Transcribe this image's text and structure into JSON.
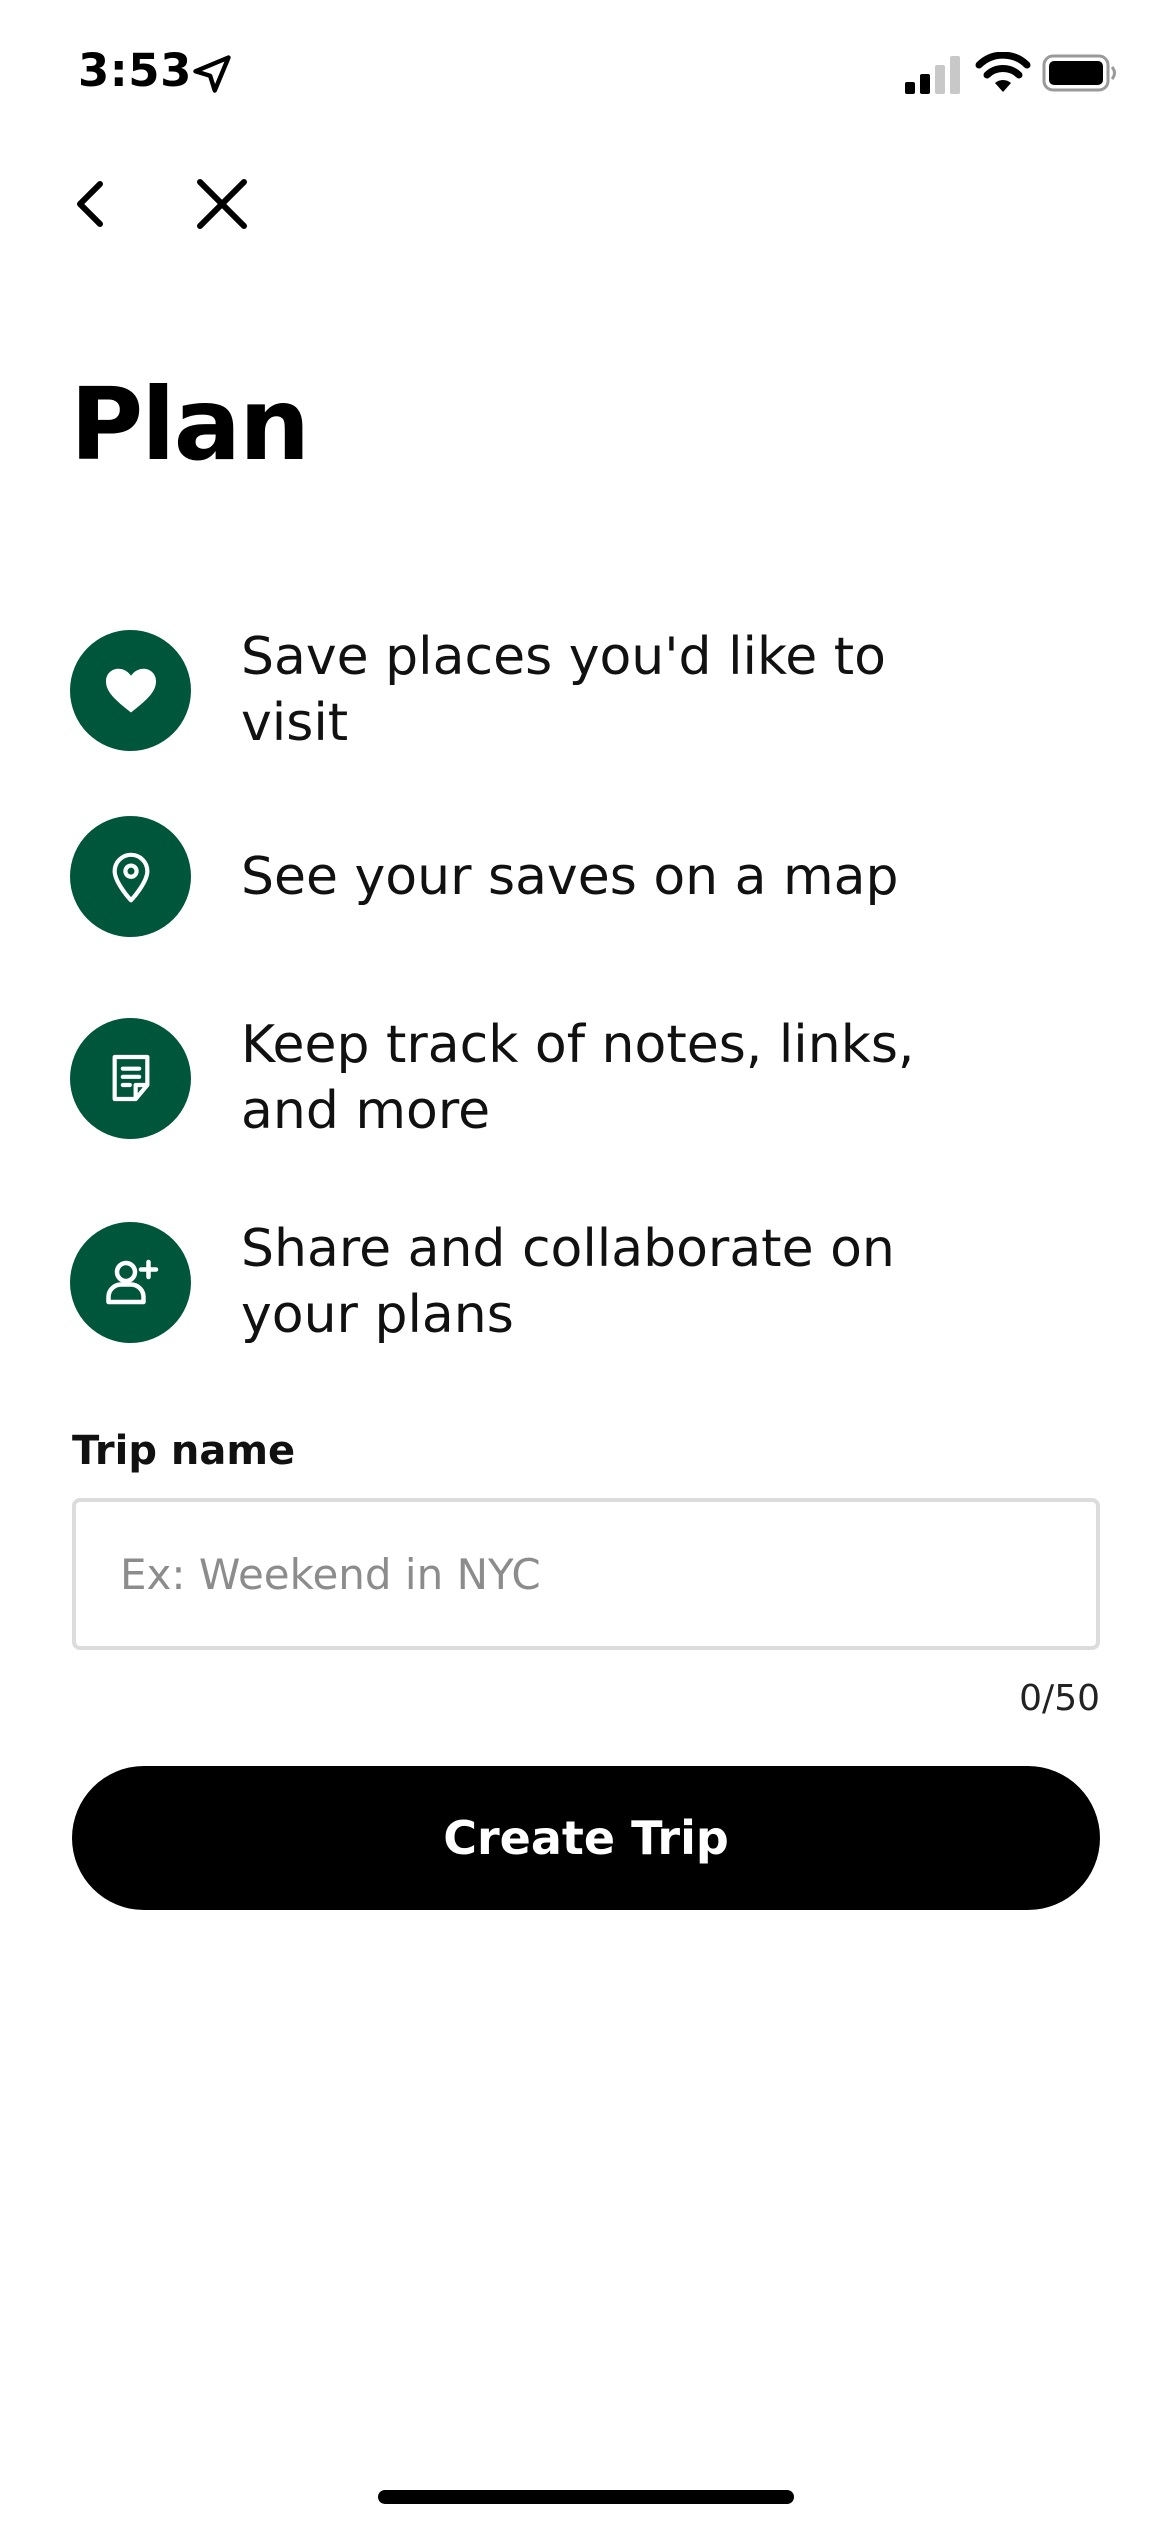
{
  "status_bar": {
    "time": "3:53"
  },
  "nav": {
    "back_icon": "chevron-left-icon",
    "close_icon": "close-icon"
  },
  "page": {
    "title": "Plan"
  },
  "features": [
    {
      "icon": "heart-icon",
      "text": "Save places you'd like to visit"
    },
    {
      "icon": "map-pin-icon",
      "text": "See your saves on a map"
    },
    {
      "icon": "note-icon",
      "text": "Keep track of notes, links, and more"
    },
    {
      "icon": "add-user-icon",
      "text": "Share and collaborate on your plans"
    }
  ],
  "trip_form": {
    "label": "Trip name",
    "placeholder": "Ex: Weekend in NYC",
    "value": "",
    "char_count": "0/50",
    "submit_label": "Create Trip"
  },
  "colors": {
    "accent_green": "#00563a",
    "button_bg": "#000000",
    "button_text": "#ffffff"
  }
}
